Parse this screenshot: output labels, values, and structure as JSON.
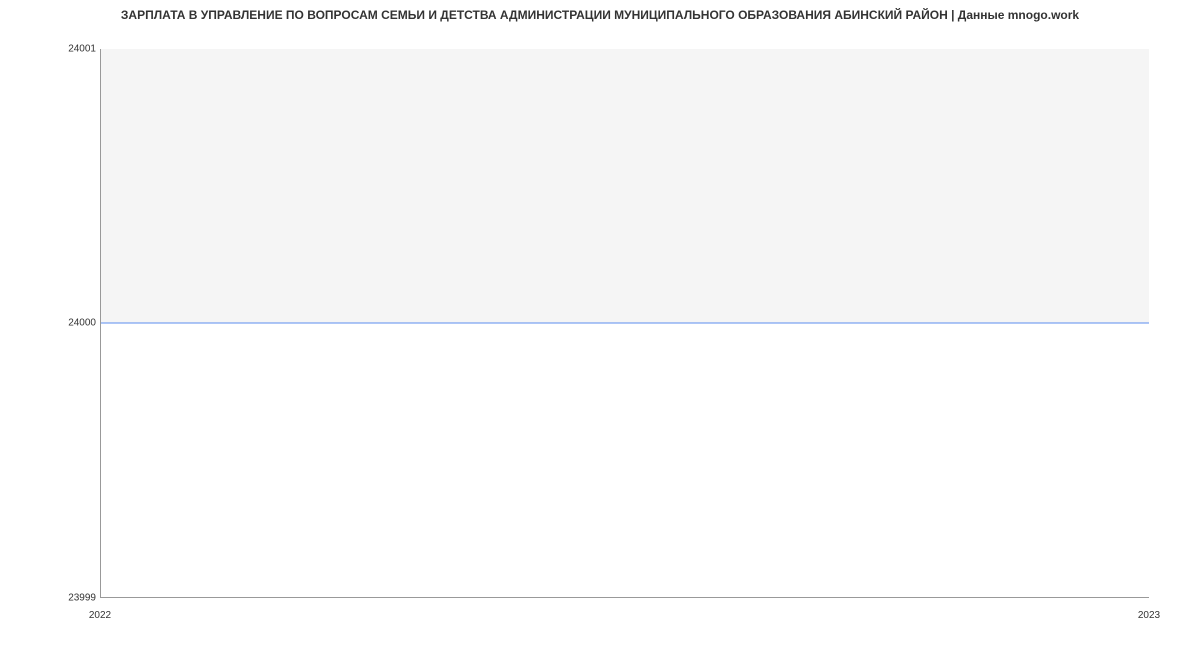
{
  "chart_data": {
    "type": "area",
    "title": "ЗАРПЛАТА В УПРАВЛЕНИЕ ПО ВОПРОСАМ СЕМЬИ И ДЕТСТВА АДМИНИСТРАЦИИ МУНИЦИПАЛЬНОГО ОБРАЗОВАНИЯ АБИНСКИЙ РАЙОН | Данные mnogo.work",
    "x": [
      "2022",
      "2023"
    ],
    "values": [
      24000,
      24000
    ],
    "xlabel": "",
    "ylabel": "",
    "ylim": [
      23999,
      24001
    ],
    "y_ticks": [
      "24001",
      "24000",
      "23999"
    ],
    "x_ticks": [
      "2022",
      "2023"
    ],
    "line_color": "#5b8def",
    "fill_color": "#ffffff",
    "plot_bg": "#f5f5f5"
  }
}
